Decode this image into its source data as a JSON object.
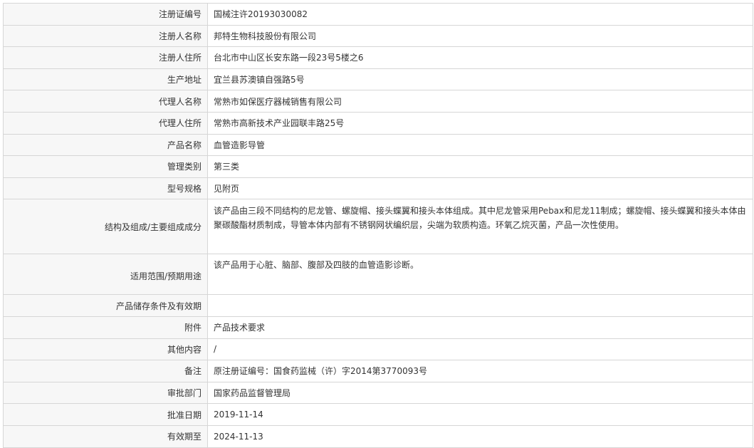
{
  "rows": [
    {
      "label": "注册证编号",
      "value": "国械注许20193030082"
    },
    {
      "label": "注册人名称",
      "value": "邦特生物科技股份有限公司"
    },
    {
      "label": "注册人住所",
      "value": "台北市中山区长安东路一段23号5楼之6"
    },
    {
      "label": "生产地址",
      "value": "宜兰县苏澳镇自强路5号"
    },
    {
      "label": "代理人名称",
      "value": "常熟市如保医疗器械销售有限公司"
    },
    {
      "label": "代理人住所",
      "value": "常熟市高新技术产业园联丰路25号"
    },
    {
      "label": "产品名称",
      "value": "血管造影导管"
    },
    {
      "label": "管理类别",
      "value": "第三类"
    },
    {
      "label": "型号规格",
      "value": "见附页"
    },
    {
      "label": "结构及组成/主要组成成分",
      "value": "该产品由三段不同结构的尼龙管、螺旋帽、接头蝶翼和接头本体组成。其中尼龙管采用Pebax和尼龙11制成；螺旋帽、接头蝶翼和接头本体由聚碳酸酯材质制成，导管本体内部有不锈钢网状编织层，尖端为软质构造。环氧乙烷灭菌，产品一次性使用。"
    },
    {
      "label": "适用范围/预期用途",
      "value": "该产品用于心脏、脑部、腹部及四肢的血管造影诊断。"
    },
    {
      "label": "产品储存条件及有效期",
      "value": ""
    },
    {
      "label": "附件",
      "value": "产品技术要求"
    },
    {
      "label": "其他内容",
      "value": "/"
    },
    {
      "label": "备注",
      "value": "原注册证编号：国食药监械（许）字2014第3770093号"
    },
    {
      "label": "审批部门",
      "value": "国家药品监督管理局"
    },
    {
      "label": "批准日期",
      "value": "2019-11-14"
    },
    {
      "label": "有效期至",
      "value": "2024-11-13"
    }
  ]
}
